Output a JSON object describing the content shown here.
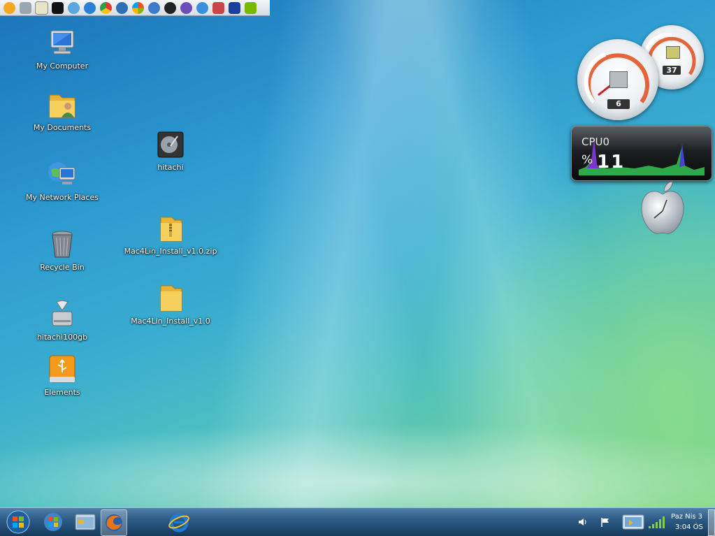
{
  "desktop": {
    "icons": [
      {
        "label": "My Computer",
        "icon": "computer-icon"
      },
      {
        "label": "My Documents",
        "icon": "documents-folder-icon"
      },
      {
        "label": "My Network Places",
        "icon": "network-places-icon"
      },
      {
        "label": "Recycle Bin",
        "icon": "recycle-bin-icon"
      },
      {
        "label": "hitachi100gb",
        "icon": "drive-icon"
      },
      {
        "label": "Elements",
        "icon": "usb-drive-icon"
      },
      {
        "label": "hitachi",
        "icon": "hard-disk-icon"
      },
      {
        "label": "Mac4Lin_Install_v1.0.zip",
        "icon": "zip-folder-icon"
      },
      {
        "label": "Mac4Lin_Install_v1.0",
        "icon": "folder-icon"
      }
    ]
  },
  "quick_launch": {
    "icons": [
      "cd-icon",
      "settings-icon",
      "notepad-icon",
      "terminal-icon",
      "network-icon",
      "internet-explorer-icon",
      "chrome-icon",
      "bird-icon",
      "windows-icon",
      "qb-icon",
      "seven-icon",
      "media-player-icon",
      "play-icon",
      "archive-icon",
      "cursor-icon",
      "nvidia-icon"
    ]
  },
  "gadgets": {
    "cpu_gauge_value": "6",
    "memory_gauge_value": "37",
    "cpu_meter": {
      "title": "CPU0",
      "percent_symbol": "%",
      "value": "11"
    }
  },
  "taskbar": {
    "start_icon": "windows-start-orb",
    "pinned": [
      "windows-icon",
      "explorer-icon",
      "firefox-icon",
      "internet-explorer-icon"
    ],
    "tray": {
      "icons": [
        "volume-icon",
        "flag-icon",
        "display-icon",
        "signal-icon"
      ],
      "date": "Paz Nis  3",
      "time": "3:04 ÖS"
    }
  },
  "colors": {
    "taskbar": "#2e5c86",
    "accent": "#3aaed0"
  }
}
